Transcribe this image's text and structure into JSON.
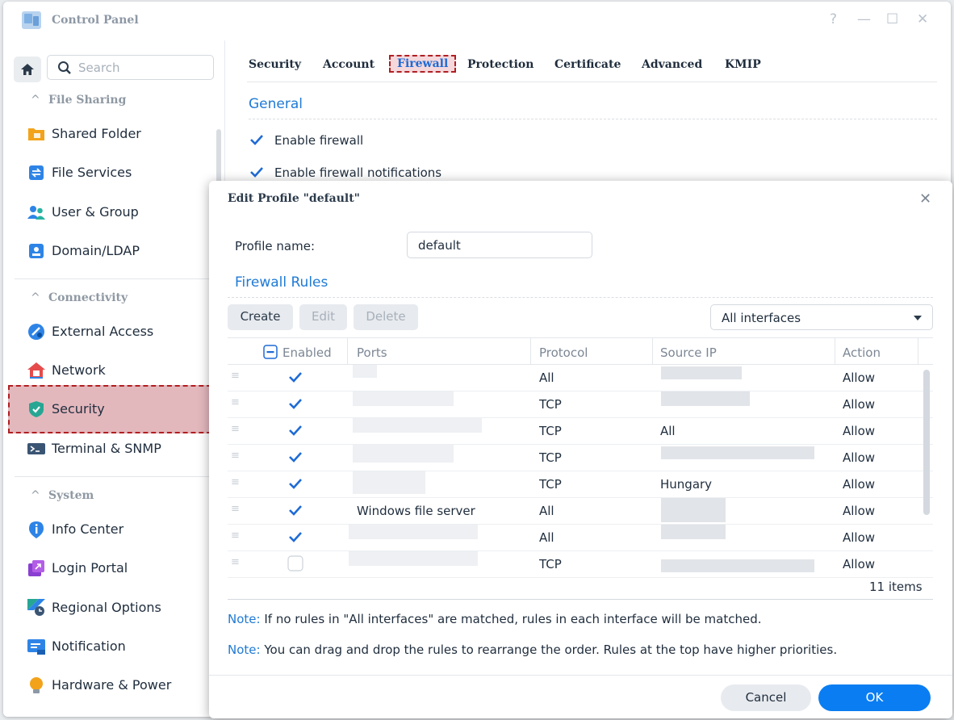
{
  "window": {
    "title": "Control Panel",
    "controls": {
      "help": "?",
      "minimize": "—",
      "maximize": "☐",
      "close": "✕"
    }
  },
  "sidebar": {
    "search_placeholder": "Search",
    "groups": {
      "file_sharing": "File Sharing",
      "connectivity": "Connectivity",
      "system": "System"
    },
    "items": [
      {
        "label": "Shared Folder",
        "icon": "folder-icon"
      },
      {
        "label": "File Services",
        "icon": "file-services-icon"
      },
      {
        "label": "User & Group",
        "icon": "users-icon"
      },
      {
        "label": "Domain/LDAP",
        "icon": "domain-icon"
      },
      {
        "label": "External Access",
        "icon": "globe-link-icon"
      },
      {
        "label": "Network",
        "icon": "house-network-icon"
      },
      {
        "label": "Security",
        "icon": "shield-icon",
        "active": true
      },
      {
        "label": "Terminal & SNMP",
        "icon": "terminal-icon"
      },
      {
        "label": "Info Center",
        "icon": "info-icon"
      },
      {
        "label": "Login Portal",
        "icon": "portal-icon"
      },
      {
        "label": "Regional Options",
        "icon": "regional-icon"
      },
      {
        "label": "Notification",
        "icon": "notification-icon"
      },
      {
        "label": "Hardware & Power",
        "icon": "bulb-icon"
      }
    ]
  },
  "tabs": [
    "Security",
    "Account",
    "Firewall",
    "Protection",
    "Certificate",
    "Advanced",
    "KMIP"
  ],
  "active_tab": "Firewall",
  "general": {
    "title": "General",
    "enable_firewall": "Enable firewall",
    "enable_notifications": "Enable firewall notifications"
  },
  "dialog": {
    "title": "Edit Profile \"default\"",
    "close": "✕",
    "profile_label": "Profile name:",
    "profile_value": "default",
    "rules_title": "Firewall Rules",
    "buttons": {
      "create": "Create",
      "edit": "Edit",
      "delete": "Delete"
    },
    "interface_select": "All interfaces",
    "columns": {
      "enabled": "Enabled",
      "ports": "Ports",
      "protocol": "Protocol",
      "source_ip": "Source IP",
      "action": "Action"
    },
    "rows": [
      {
        "enabled": true,
        "ports": "",
        "protocol": "All",
        "source_ip": "",
        "action": "Allow"
      },
      {
        "enabled": true,
        "ports": "",
        "protocol": "TCP",
        "source_ip": "",
        "action": "Allow"
      },
      {
        "enabled": true,
        "ports": "",
        "protocol": "TCP",
        "source_ip": "All",
        "action": "Allow"
      },
      {
        "enabled": true,
        "ports": "",
        "protocol": "TCP",
        "source_ip": "",
        "action": "Allow"
      },
      {
        "enabled": true,
        "ports": "",
        "protocol": "TCP",
        "source_ip": "Hungary",
        "action": "Allow"
      },
      {
        "enabled": true,
        "ports": "Windows file server",
        "protocol": "All",
        "source_ip": "",
        "action": "Allow"
      },
      {
        "enabled": true,
        "ports": "",
        "protocol": "All",
        "source_ip": "",
        "action": "Allow"
      },
      {
        "enabled": false,
        "ports": "",
        "protocol": "TCP",
        "source_ip": "",
        "action": "Allow"
      }
    ],
    "item_count": "11 items",
    "note_label": "Note:",
    "note1": "If no rules in \"All interfaces\" are matched, rules in each interface will be matched.",
    "note2": "You can drag and drop the rules to rearrange the order. Rules at the top have higher priorities.",
    "cancel": "Cancel",
    "ok": "OK"
  },
  "colors": {
    "accent": "#1f7ad6",
    "primary_button": "#0a7df2",
    "highlight_border": "#b01f22"
  }
}
